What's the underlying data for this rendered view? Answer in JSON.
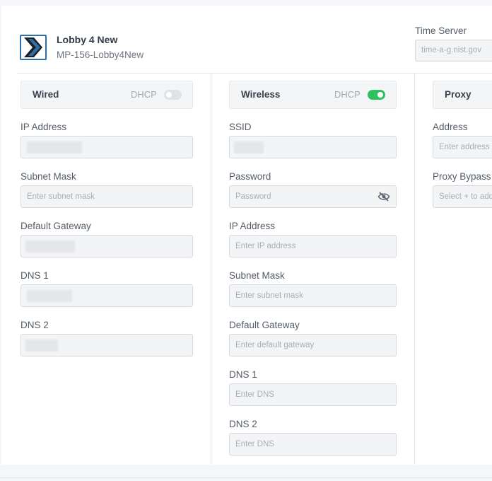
{
  "device": {
    "name": "Lobby 4 New",
    "id": "MP-156-Lobby4New"
  },
  "time_server": {
    "label": "Time Server",
    "placeholder": "time-a-g.nist.gov"
  },
  "wired": {
    "title": "Wired",
    "dhcp_label": "DHCP",
    "dhcp_enabled": false,
    "fields": {
      "ip_label": "IP Address",
      "subnet_label": "Subnet Mask",
      "subnet_placeholder": "Enter subnet mask",
      "gateway_label": "Default Gateway",
      "dns1_label": "DNS 1",
      "dns2_label": "DNS 2"
    }
  },
  "wireless": {
    "title": "Wireless",
    "dhcp_label": "DHCP",
    "dhcp_enabled": true,
    "fields": {
      "ssid_label": "SSID",
      "password_label": "Password",
      "password_placeholder": "Password",
      "ip_label": "IP Address",
      "ip_placeholder": "Enter IP address",
      "subnet_label": "Subnet Mask",
      "subnet_placeholder": "Enter subnet mask",
      "gateway_label": "Default Gateway",
      "gateway_placeholder": "Enter default gateway",
      "dns1_label": "DNS 1",
      "dns1_placeholder": "Enter DNS",
      "dns2_label": "DNS 2",
      "dns2_placeholder": "Enter DNS"
    }
  },
  "proxy": {
    "title": "Proxy",
    "address_label": "Address",
    "address_placeholder": "Enter address",
    "bypass_label": "Proxy Bypass",
    "bypass_placeholder": "Select + to add"
  },
  "colors": {
    "toggle_on": "#2fc05f",
    "toggle_off": "#dfe2e6",
    "logo_blue": "#2f6fa8"
  },
  "icons": {
    "device_logo": "play-chevron-logo",
    "password_visibility": "eye-slash-icon"
  }
}
